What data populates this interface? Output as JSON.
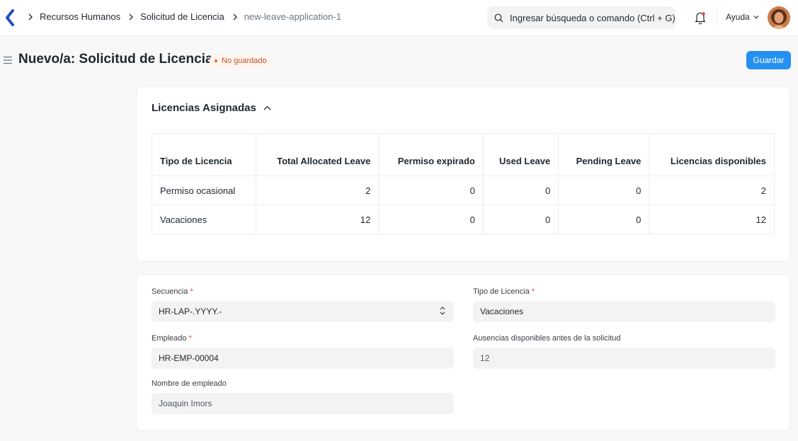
{
  "navbar": {
    "breadcrumbs": [
      {
        "label": "Recursos Humanos"
      },
      {
        "label": "Solicitud de Licencia"
      },
      {
        "label": "new-leave-application-1"
      }
    ],
    "search_placeholder": "Ingresar búsqueda o comando (Ctrl + G)",
    "help_label": "Ayuda"
  },
  "page": {
    "title": "Nuevo/a: Solicitud de Licencia",
    "status": "No guardado",
    "save_label": "Guardar"
  },
  "allocated": {
    "title": "Licencias Asignadas",
    "columns": [
      "Tipo de Licencia",
      "Total Allocated Leave",
      "Permiso expirado",
      "Used Leave",
      "Pending Leave",
      "Licencias disponibles"
    ],
    "rows": [
      {
        "type": "Permiso ocasional",
        "total": "2",
        "expired": "0",
        "used": "0",
        "pending": "0",
        "available": "2"
      },
      {
        "type": "Vacaciones",
        "total": "12",
        "expired": "0",
        "used": "0",
        "pending": "0",
        "available": "12"
      }
    ]
  },
  "form": {
    "naming_series": {
      "label": "Secuencia",
      "value": "HR-LAP-.YYYY.-"
    },
    "employee": {
      "label": "Empleado",
      "value": "HR-EMP-00004"
    },
    "employee_name": {
      "label": "Nombre de empleado",
      "value": "Joaquin Imors"
    },
    "leave_type": {
      "label": "Tipo de Licencia",
      "value": "Vacaciones"
    },
    "leave_balance": {
      "label": "Ausencias disponibles antes de la solicitud",
      "value": "12"
    }
  },
  "colors": {
    "primary": "#2490ef",
    "status_text": "#bf4f1f",
    "status_bg": "#fff5f0"
  },
  "icons": [
    "back-logo-icon",
    "chevron-right-icon",
    "search-icon",
    "bell-icon",
    "chevron-down-icon",
    "menu-icon",
    "chevron-up-icon",
    "select-updown-icon"
  ]
}
